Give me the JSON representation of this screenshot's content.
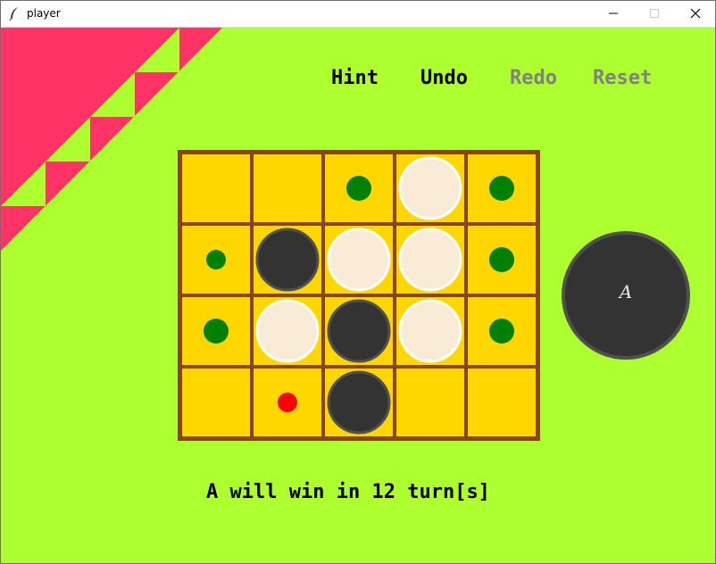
{
  "window": {
    "title": "player",
    "icon": "feather-icon",
    "controls": [
      "minimize-icon",
      "maximize-icon",
      "close-icon"
    ]
  },
  "menu": {
    "hint_label": "Hint",
    "undo_label": "Undo",
    "redo_label": "Redo",
    "reset_label": "Reset",
    "enabled_color": "#000000",
    "disabled_color": "#808080"
  },
  "board": {
    "rows": 4,
    "cols": 5,
    "cells": [
      [
        "empty",
        "empty",
        "move-large",
        "white",
        "move-large"
      ],
      [
        "move-small",
        "black",
        "white",
        "white",
        "move-large"
      ],
      [
        "move-large",
        "white",
        "black",
        "white",
        "move-large"
      ],
      [
        "empty",
        "hint",
        "black",
        "empty",
        "empty"
      ]
    ],
    "colors": {
      "background": "#adff2f",
      "cell": "#ffd700",
      "grid": "#8b4513",
      "black_piece": "#333333",
      "black_outline": "#505050",
      "white_piece": "#faebd7",
      "white_outline": "#ffffff",
      "move_dot": "#008000",
      "hint_dot": "#ff0000",
      "decor_pink": "#ff3366"
    }
  },
  "player": {
    "label": "A",
    "fill": "#333333",
    "outline": "#505050"
  },
  "status": {
    "message": "A will win in 12 turn[s]"
  }
}
